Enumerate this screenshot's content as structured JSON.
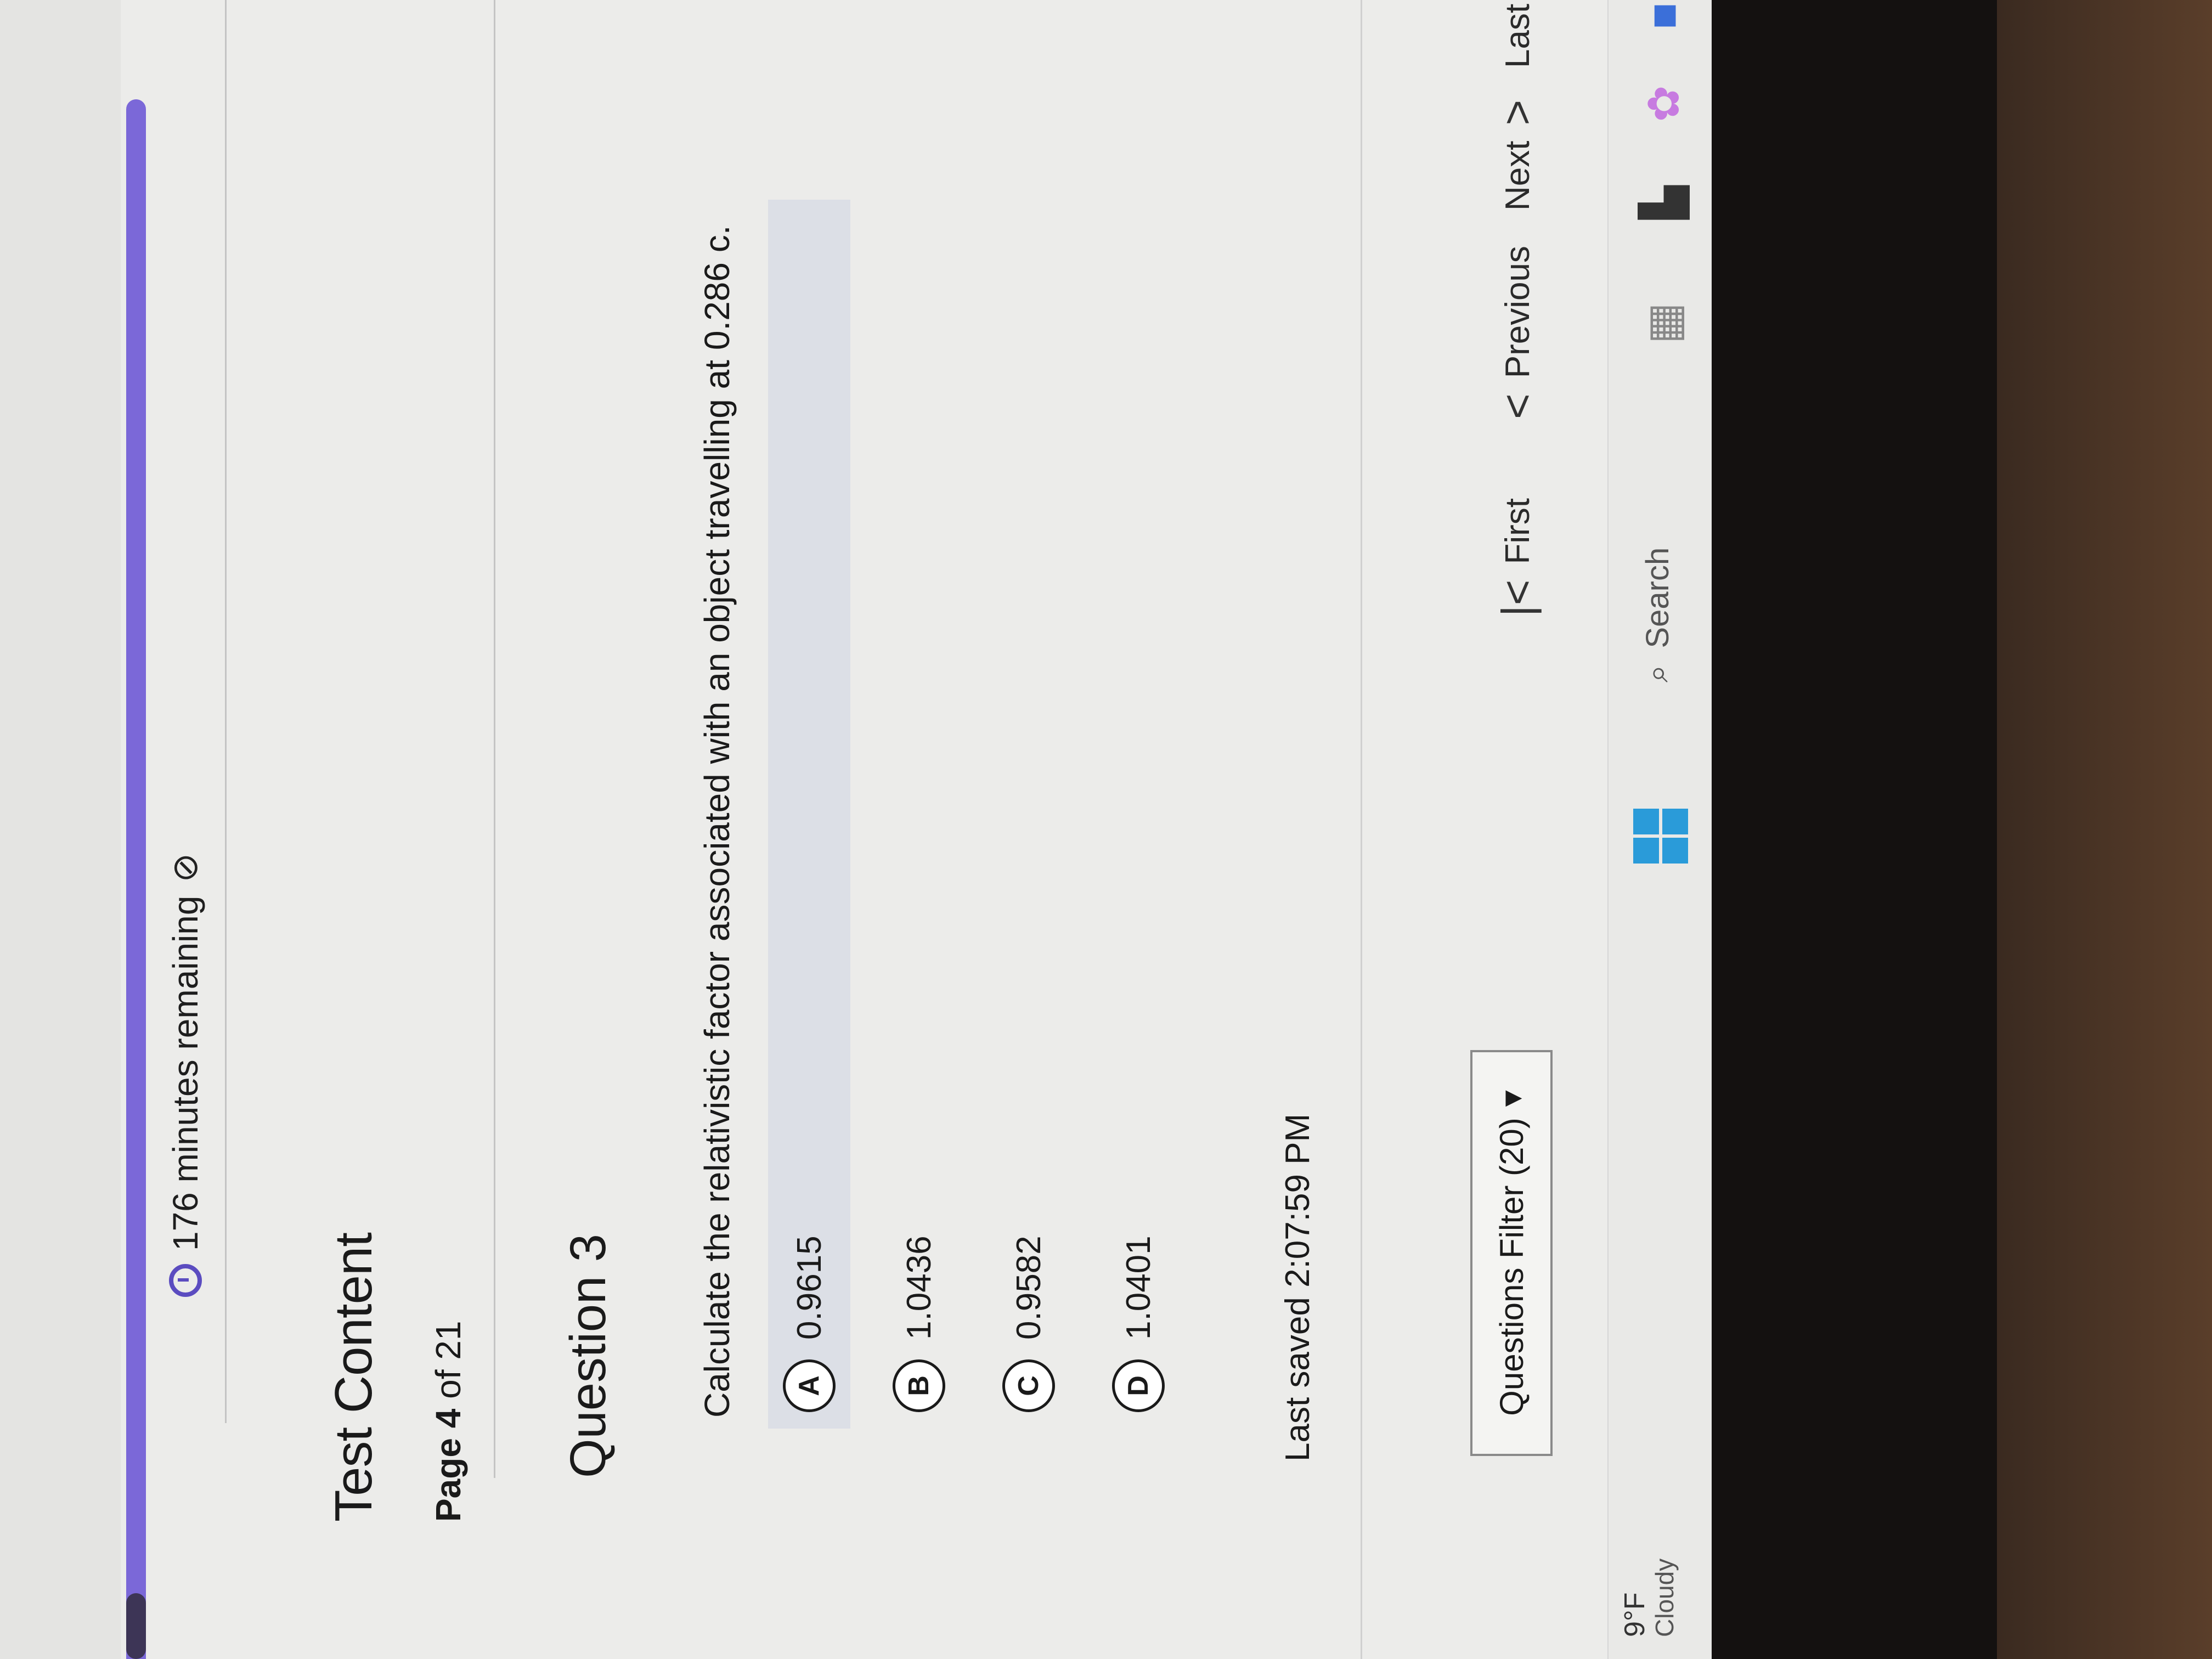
{
  "timer": {
    "text": "176 minutes remaining",
    "progress_fraction": 0.94
  },
  "header": {
    "title": "Test Content",
    "page_label": "Page",
    "page_current": "4",
    "page_of": "of 21"
  },
  "question": {
    "title": "Question 3",
    "text": "Calculate the relativistic factor associated with an object travelling at 0.286 c.",
    "options": [
      {
        "letter": "A",
        "value": "0.9615",
        "selected": true
      },
      {
        "letter": "B",
        "value": "1.0436",
        "selected": false
      },
      {
        "letter": "C",
        "value": "0.9582",
        "selected": false
      },
      {
        "letter": "D",
        "value": "1.0401",
        "selected": false
      }
    ]
  },
  "footer": {
    "last_saved": "Last saved 2:07:59 PM",
    "filter_label": "Questions Filter (20)",
    "nav": {
      "first": "First",
      "previous": "Previous",
      "next": "Next",
      "last": "Last"
    }
  },
  "taskbar": {
    "temperature": "9°F",
    "condition": "Cloudy",
    "search_placeholder": "Search"
  },
  "colors": {
    "accent": "#7b68d8",
    "accent_dark": "#3d3556",
    "selected_bg": "#dcdfe6"
  }
}
